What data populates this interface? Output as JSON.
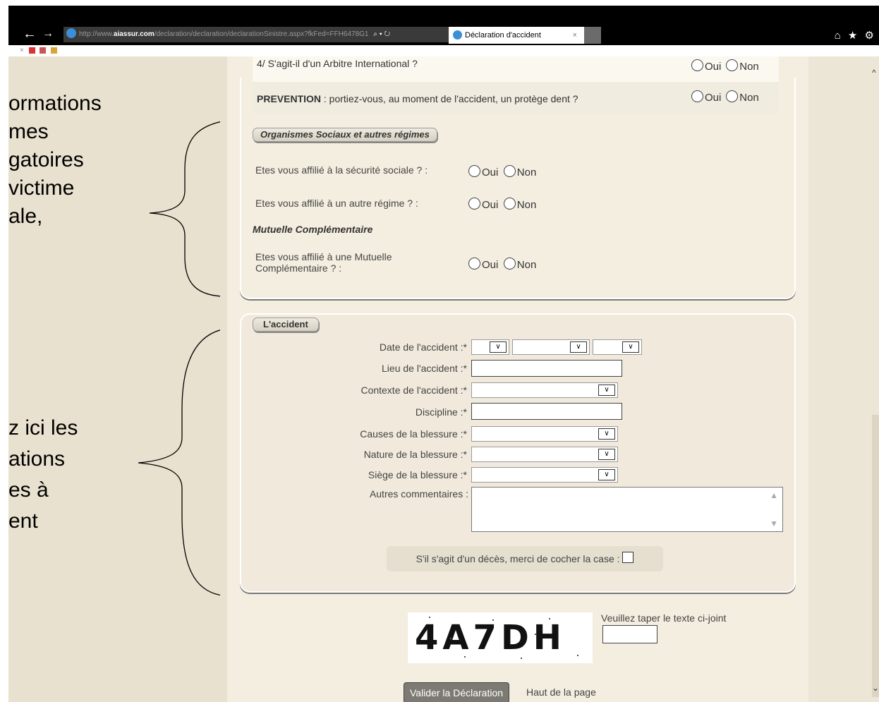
{
  "browser": {
    "url_prefix": "http://www.",
    "url_domain": "aiassur.com",
    "url_path": "/declaration/declaration/declarationSinistre.aspx?fkFed=FFH6478G1",
    "url_controls": "⌕ ▾ ↻",
    "tab_title": "Déclaration d'accident",
    "tab_close": "×",
    "back_glyph": "←",
    "forward_glyph": "→",
    "toolbar_glyphs": "⌂ ★ ⚙",
    "toolbar2_close": "×"
  },
  "annotations": {
    "top": [
      "ormations",
      "mes",
      "gatoires",
      " victime",
      "ale,"
    ],
    "bottom": [
      "z ici les",
      "ations",
      "es à",
      "ent"
    ]
  },
  "questions": {
    "q4_label": "4/ S'agit-il d'un Arbitre International ?",
    "prevention_strong": "PREVENTION",
    "prevention_rest": " : portiez-vous, au moment de l'accident, un protège dent ?",
    "opt_oui": "Oui",
    "opt_non": "Non"
  },
  "organismes": {
    "legend": "Organismes Sociaux et autres régimes",
    "secu_label": "Etes vous affilié à la sécurité sociale ? :",
    "autre_label": "Etes vous affilié à un autre régime ? :",
    "mutuelle_title": "Mutuelle Complémentaire",
    "mutuelle_label_1": "Etes vous affilié à une Mutuelle",
    "mutuelle_label_2": "Complémentaire ? :"
  },
  "accident": {
    "legend": "L'accident",
    "date_label": "Date de l'accident :*",
    "lieu_label": "Lieu de l'accident :*",
    "contexte_label": "Contexte de l'accident :*",
    "discipline_label": "Discipline :*",
    "causes_label": "Causes de la blessure :*",
    "nature_label": "Nature de la blessure :*",
    "siege_label": "Siège de la blessure :*",
    "commentaires_label": "Autres commentaires :",
    "deces_label": "S'il s'agit d'un décès, merci de cocher la case :",
    "chevron": "∨"
  },
  "captcha": {
    "text": "4A7DH",
    "hint": "Veuillez taper le texte ci-joint"
  },
  "actions": {
    "submit": "Valider la Déclaration",
    "top_link": "Haut de la page"
  }
}
